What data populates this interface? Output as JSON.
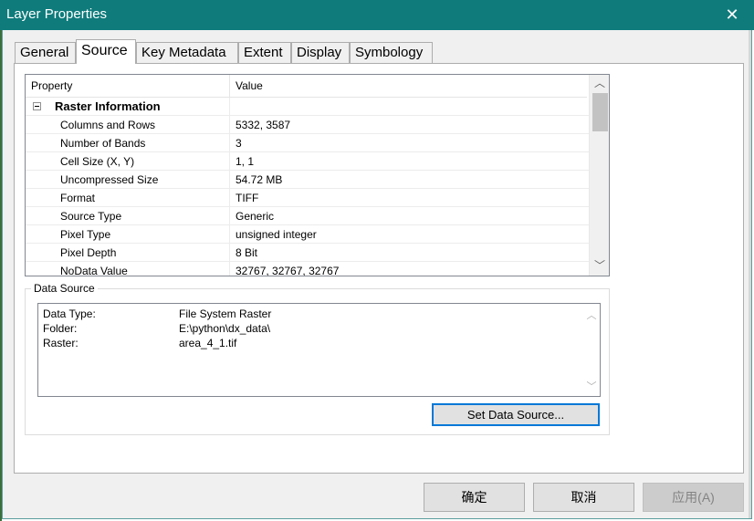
{
  "window": {
    "title": "Layer Properties",
    "close_glyph": "✕"
  },
  "tabs": [
    {
      "label": "General",
      "active": false
    },
    {
      "label": "Source",
      "active": true
    },
    {
      "label": "Key Metadata",
      "active": false
    },
    {
      "label": "Extent",
      "active": false
    },
    {
      "label": "Display",
      "active": false
    },
    {
      "label": "Symbology",
      "active": false
    }
  ],
  "property_grid": {
    "headers": {
      "property": "Property",
      "value": "Value"
    },
    "group": "Raster Information",
    "rows": [
      {
        "property": "Columns and Rows",
        "value": "5332, 3587"
      },
      {
        "property": "Number of Bands",
        "value": "3"
      },
      {
        "property": "Cell Size (X, Y)",
        "value": "1, 1"
      },
      {
        "property": "Uncompressed Size",
        "value": "54.72 MB"
      },
      {
        "property": "Format",
        "value": "TIFF"
      },
      {
        "property": "Source Type",
        "value": "Generic"
      },
      {
        "property": "Pixel Type",
        "value": "unsigned integer"
      },
      {
        "property": "Pixel Depth",
        "value": "8 Bit"
      },
      {
        "property": "NoData Value",
        "value": "32767, 32767, 32767"
      }
    ]
  },
  "data_source": {
    "legend": "Data Source",
    "lines": [
      {
        "key": "Data Type:",
        "value": "File System Raster"
      },
      {
        "key": "Folder:",
        "value": "E:\\python\\dx_data\\"
      },
      {
        "key": "Raster:",
        "value": "area_4_1.tif"
      }
    ],
    "set_button": "Set Data Source..."
  },
  "buttons": {
    "ok": "确定",
    "cancel": "取消",
    "apply": "应用(A)"
  },
  "colors": {
    "titlebar": "#0f7b7b",
    "focus_border": "#0078d7"
  }
}
